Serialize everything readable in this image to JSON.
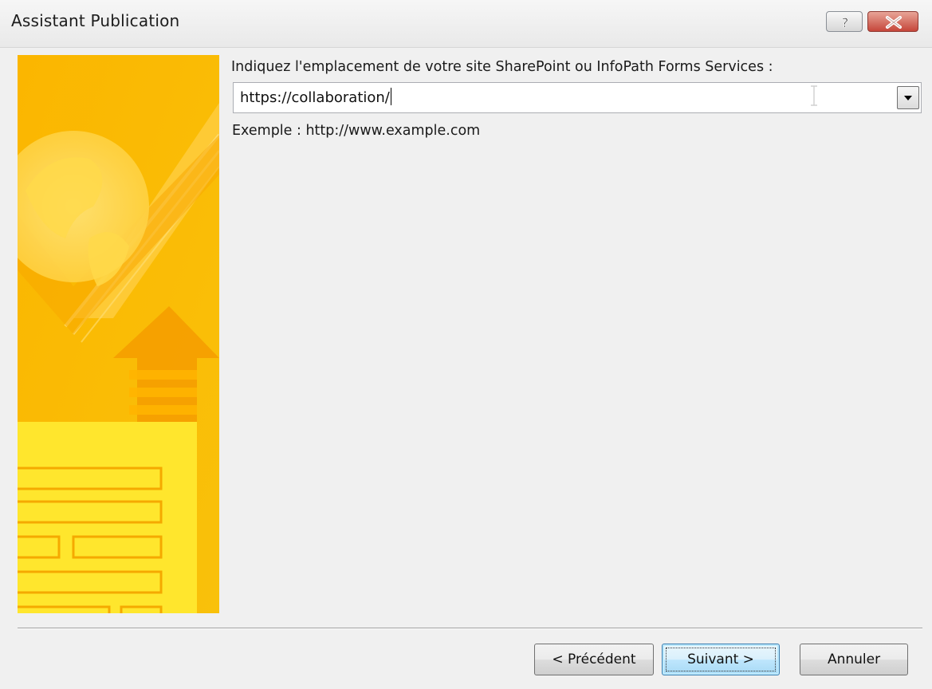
{
  "window": {
    "title": "Assistant Publication",
    "help_icon": "help-icon",
    "close_icon": "close-icon"
  },
  "form": {
    "location_label": "Indiquez l'emplacement de votre site SharePoint ou InfoPath Forms Services :",
    "location_value": "https://collaboration/",
    "example_text": "Exemple : http://www.example.com"
  },
  "buttons": {
    "previous": "< Précédent",
    "next": "Suivant >",
    "cancel": "Annuler"
  },
  "colors": {
    "banner_primary": "#f9b800",
    "banner_light": "#ffe25a",
    "next_button_border": "#3c7fb1",
    "close_button": "#c6463a"
  }
}
